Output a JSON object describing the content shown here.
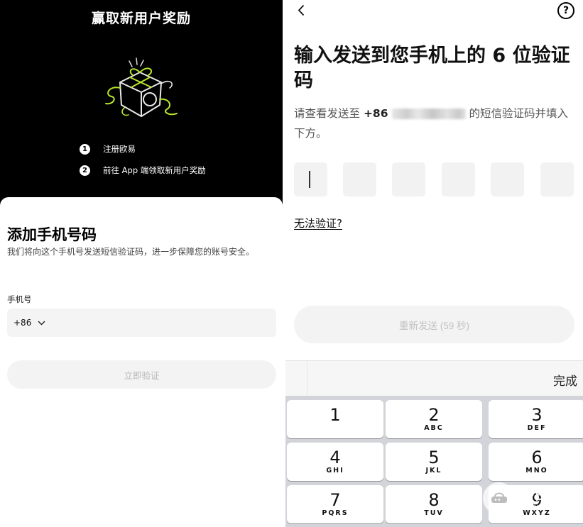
{
  "left": {
    "promo": {
      "title": "赢取新用户奖励",
      "steps": [
        {
          "num": "1",
          "text": "注册欧易"
        },
        {
          "num": "2",
          "text": "前往 App 端领取新用户奖励"
        }
      ]
    },
    "sheet": {
      "title": "添加手机号码",
      "description": "我们将向这个手机号发送短信验证码，进一步保障您的账号安全。",
      "phone_label": "手机号",
      "country_code": "+86",
      "verify_button": "立即验证"
    }
  },
  "right": {
    "title": "输入发送到您手机上的 6 位验证码",
    "desc_prefix": "请查看发送至 ",
    "desc_number": "+86",
    "desc_suffix": "的短信验证码并填入下方。",
    "otp_digits": [
      "",
      "",
      "",
      "",
      "",
      ""
    ],
    "cant_verify": "无法验证?",
    "resend_button": "重新发送 (59 秒)",
    "keyboard": {
      "done": "完成",
      "keys": [
        {
          "num": "1",
          "letters": ""
        },
        {
          "num": "2",
          "letters": "ABC"
        },
        {
          "num": "3",
          "letters": "DEF"
        },
        {
          "num": "4",
          "letters": "GHI"
        },
        {
          "num": "5",
          "letters": "JKL"
        },
        {
          "num": "6",
          "letters": "MNO"
        },
        {
          "num": "7",
          "letters": "PQRS"
        },
        {
          "num": "8",
          "letters": "TUV"
        },
        {
          "num": "9",
          "letters": "WXYZ"
        }
      ]
    }
  },
  "watermark": {
    "name": "路由器",
    "url": "luyouqi.com"
  },
  "colors": {
    "promo_bg": "#000000",
    "gift_accent": "#b8e62c",
    "field_bg": "#f4f4f4",
    "disabled_text": "#b8b8b8",
    "keypad_bg": "#d2d4d9"
  }
}
